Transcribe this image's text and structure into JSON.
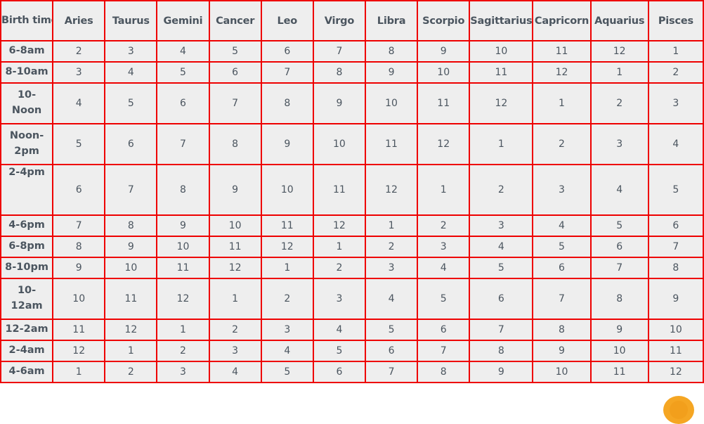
{
  "table": {
    "corner_header": "Birth time:",
    "column_headers": [
      "Aries",
      "Taurus",
      "Gemini",
      "Cancer",
      "Leo",
      "Virgo",
      "Libra",
      "Scorpio",
      "Sagittarius",
      "Capricorn",
      "Aquarius",
      "Pisces"
    ],
    "row_headers": [
      "6-8am",
      "8-10am",
      "10-Noon",
      "Noon-2pm",
      "2-4pm",
      "4-6pm",
      "6-8pm",
      "8-10pm",
      "10-12am",
      "12-2am",
      "2-4am",
      "4-6am"
    ],
    "rows": [
      {
        "label": "6-8am",
        "values": [
          2,
          3,
          4,
          5,
          6,
          7,
          8,
          9,
          10,
          11,
          12,
          1
        ]
      },
      {
        "label": "8-10am",
        "values": [
          3,
          4,
          5,
          6,
          7,
          8,
          9,
          10,
          11,
          12,
          1,
          2
        ]
      },
      {
        "label": "10-Noon",
        "values": [
          4,
          5,
          6,
          7,
          8,
          9,
          10,
          11,
          12,
          1,
          2,
          3
        ]
      },
      {
        "label": "Noon-2pm",
        "values": [
          5,
          6,
          7,
          8,
          9,
          10,
          11,
          12,
          1,
          2,
          3,
          4
        ]
      },
      {
        "label": "2-4pm",
        "values": [
          6,
          7,
          8,
          9,
          10,
          11,
          12,
          1,
          2,
          3,
          4,
          5
        ]
      },
      {
        "label": "4-6pm",
        "values": [
          7,
          8,
          9,
          10,
          11,
          12,
          1,
          2,
          3,
          4,
          5,
          6
        ]
      },
      {
        "label": "6-8pm",
        "values": [
          8,
          9,
          10,
          11,
          12,
          1,
          2,
          3,
          4,
          5,
          6,
          7
        ]
      },
      {
        "label": "8-10pm",
        "values": [
          9,
          10,
          11,
          12,
          1,
          2,
          3,
          4,
          5,
          6,
          7,
          8
        ]
      },
      {
        "label": "10-12am",
        "values": [
          10,
          11,
          12,
          1,
          2,
          3,
          4,
          5,
          6,
          7,
          8,
          9
        ]
      },
      {
        "label": "12-2am",
        "values": [
          11,
          12,
          1,
          2,
          3,
          4,
          5,
          6,
          7,
          8,
          9,
          10
        ]
      },
      {
        "label": "2-4am",
        "values": [
          12,
          1,
          2,
          3,
          4,
          5,
          6,
          7,
          8,
          9,
          10,
          11
        ]
      },
      {
        "label": "4-6am",
        "values": [
          1,
          2,
          3,
          4,
          5,
          6,
          7,
          8,
          9,
          10,
          11,
          12
        ]
      }
    ]
  },
  "style": {
    "border_color": "#ee0000",
    "cell_background": "#eeeeee",
    "header_text_color": "#434d57",
    "data_text_color": "#5a646e",
    "badge_color": "#f5a623"
  }
}
